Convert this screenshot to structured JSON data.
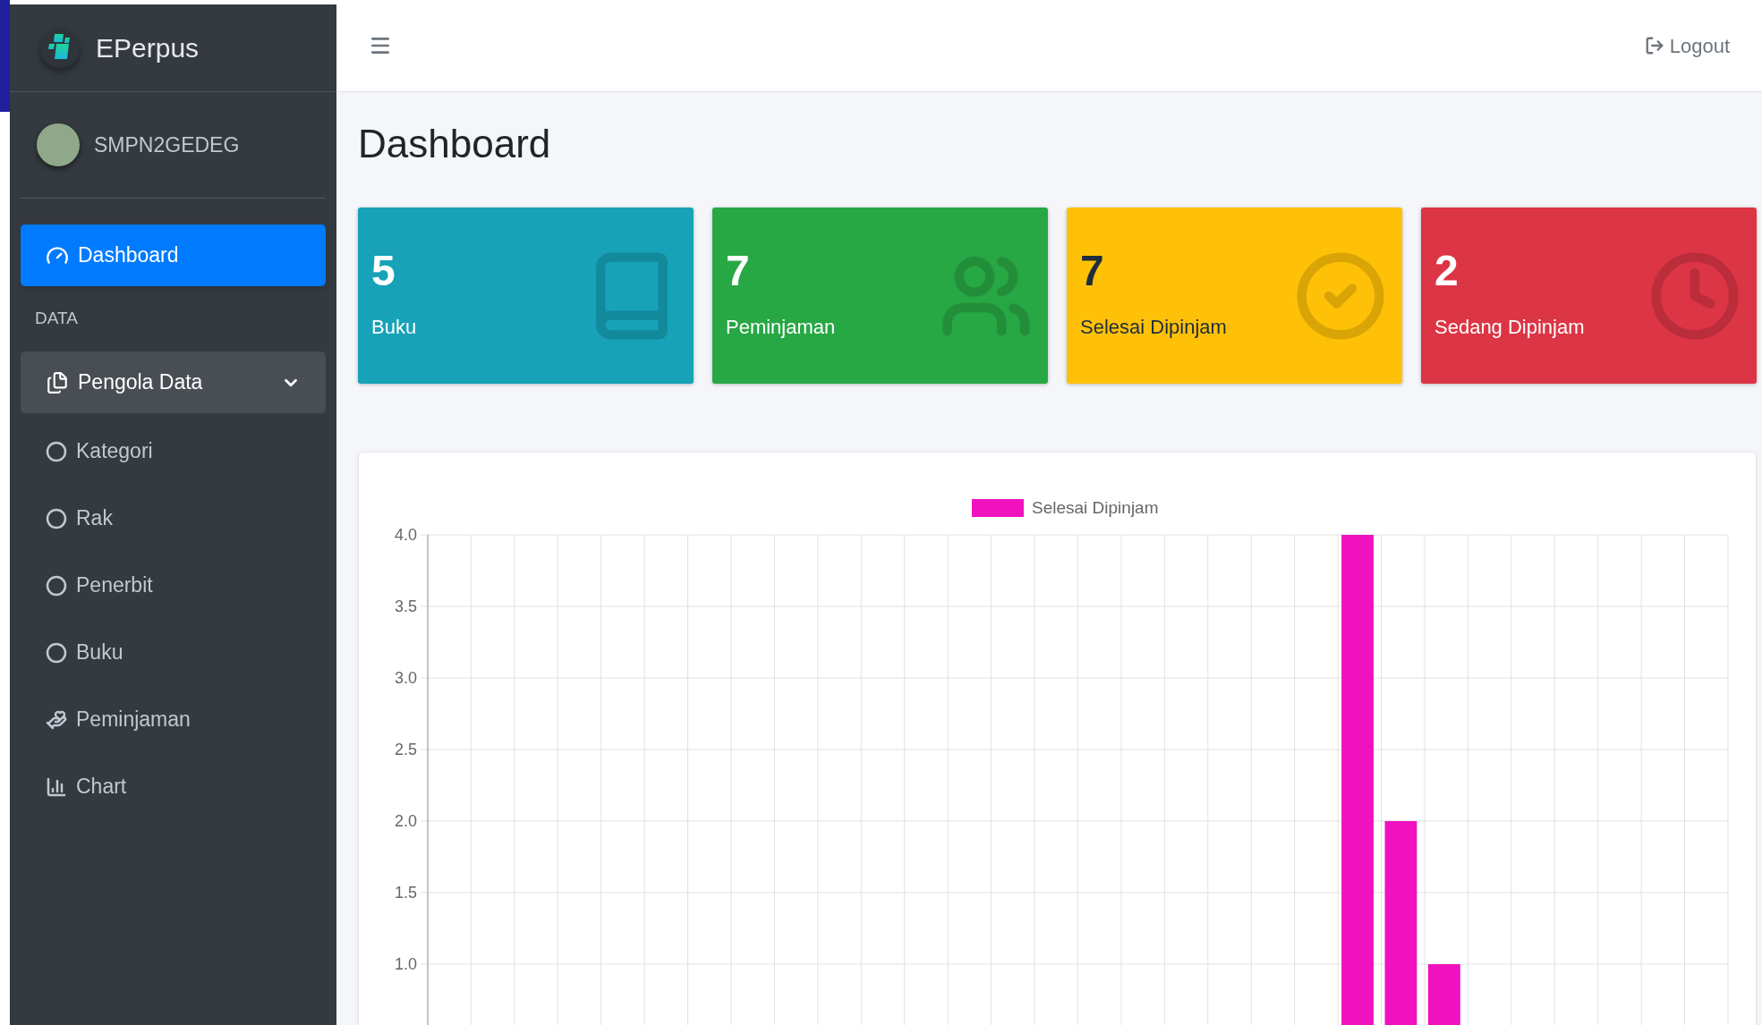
{
  "brand": {
    "name": "EPerpus"
  },
  "user": {
    "name": "SMPN2GEDEG"
  },
  "sidebar": {
    "items": [
      {
        "kind": "link",
        "label": "Dashboard",
        "selected": true
      },
      {
        "kind": "header",
        "label": "DATA"
      },
      {
        "kind": "group",
        "label": "Pengola Data",
        "selected": false,
        "expanded": true,
        "children": [
          {
            "label": "Kategori",
            "selected": false
          },
          {
            "label": "Rak",
            "selected": false
          },
          {
            "label": "Penerbit",
            "selected": false
          },
          {
            "label": "Buku",
            "selected": false
          }
        ]
      },
      {
        "kind": "link",
        "label": "Peminjaman",
        "selected": false
      },
      {
        "kind": "link",
        "label": "Chart",
        "selected": false
      }
    ]
  },
  "header": {
    "logout": "Logout"
  },
  "page_title": "Dashboard",
  "stat_cards": [
    {
      "value": "5",
      "label": "Buku",
      "color": "#17a2b8"
    },
    {
      "value": "7",
      "label": "Peminjaman",
      "color": "#28a745"
    },
    {
      "value": "7",
      "label": "Selesai Dipinjam",
      "color": "#ffc107"
    },
    {
      "value": "2",
      "label": "Sedang Dipinjam",
      "color": "#dc3545"
    }
  ],
  "chart": {
    "chart_data": {
      "type": "bar",
      "ylim": [
        0,
        4
      ],
      "grid": true,
      "series": [
        {
          "name": "Selesai Dipinjam",
          "color": "#f012be",
          "values": [
            null,
            null,
            null,
            null,
            null,
            null,
            null,
            null,
            null,
            null,
            null,
            null,
            null,
            null,
            null,
            null,
            null,
            null,
            null,
            null,
            null,
            4,
            2,
            1,
            null,
            null,
            null,
            null,
            null,
            null
          ]
        }
      ],
      "yticks": [
        {
          "value": 1,
          "label": "1.0"
        },
        {
          "value": 1.5,
          "label": "1.5"
        },
        {
          "value": 2,
          "label": "2.0"
        },
        {
          "value": 2.5,
          "label": "2.5"
        },
        {
          "value": 3,
          "label": "3.0"
        },
        {
          "value": 3.5,
          "label": "3.5"
        },
        {
          "value": 4,
          "label": "4.0"
        }
      ]
    }
  }
}
